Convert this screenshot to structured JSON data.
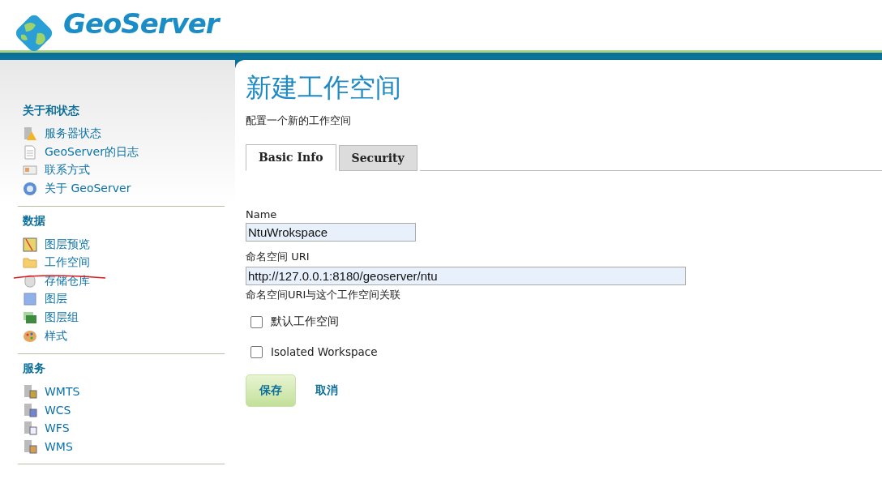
{
  "logo": {
    "text": "GeoServer"
  },
  "sidebar": {
    "sections": [
      {
        "title": "关于和状态",
        "items": [
          {
            "label": "服务器状态",
            "kind": "status"
          },
          {
            "label": "GeoServer的日志",
            "kind": "log"
          },
          {
            "label": "联系方式",
            "kind": "contact"
          },
          {
            "label": "关于 GeoServer",
            "kind": "about"
          }
        ]
      },
      {
        "title": "数据",
        "items": [
          {
            "label": "图层预览",
            "kind": "preview"
          },
          {
            "label": "工作空间",
            "kind": "folder"
          },
          {
            "label": "存储仓库",
            "kind": "store"
          },
          {
            "label": "图层",
            "kind": "layer"
          },
          {
            "label": "图层组",
            "kind": "layergroup"
          },
          {
            "label": "样式",
            "kind": "style"
          }
        ]
      },
      {
        "title": "服务",
        "items": [
          {
            "label": "WMTS",
            "kind": "wmts"
          },
          {
            "label": "WCS",
            "kind": "wcs"
          },
          {
            "label": "WFS",
            "kind": "wfs"
          },
          {
            "label": "WMS",
            "kind": "wms"
          }
        ]
      }
    ]
  },
  "page": {
    "title": "新建工作空间",
    "description": "配置一个新的工作空间",
    "tabs": [
      {
        "label": "Basic Info",
        "selected": true
      },
      {
        "label": "Security",
        "selected": false
      }
    ],
    "name_field": {
      "label": "Name",
      "value": "NtuWrokspace"
    },
    "uri_field": {
      "label": "命名空间 URI",
      "value": "http://127.0.0.1:8180/geoserver/ntu",
      "help": "命名空间URI与这个工作空间关联"
    },
    "checkboxes": [
      {
        "label": "默认工作空间",
        "checked": false
      },
      {
        "label": "Isolated Workspace",
        "checked": false
      }
    ],
    "buttons": [
      {
        "label": "保存",
        "kind": "primary"
      },
      {
        "label": "取消",
        "kind": "link"
      }
    ]
  }
}
